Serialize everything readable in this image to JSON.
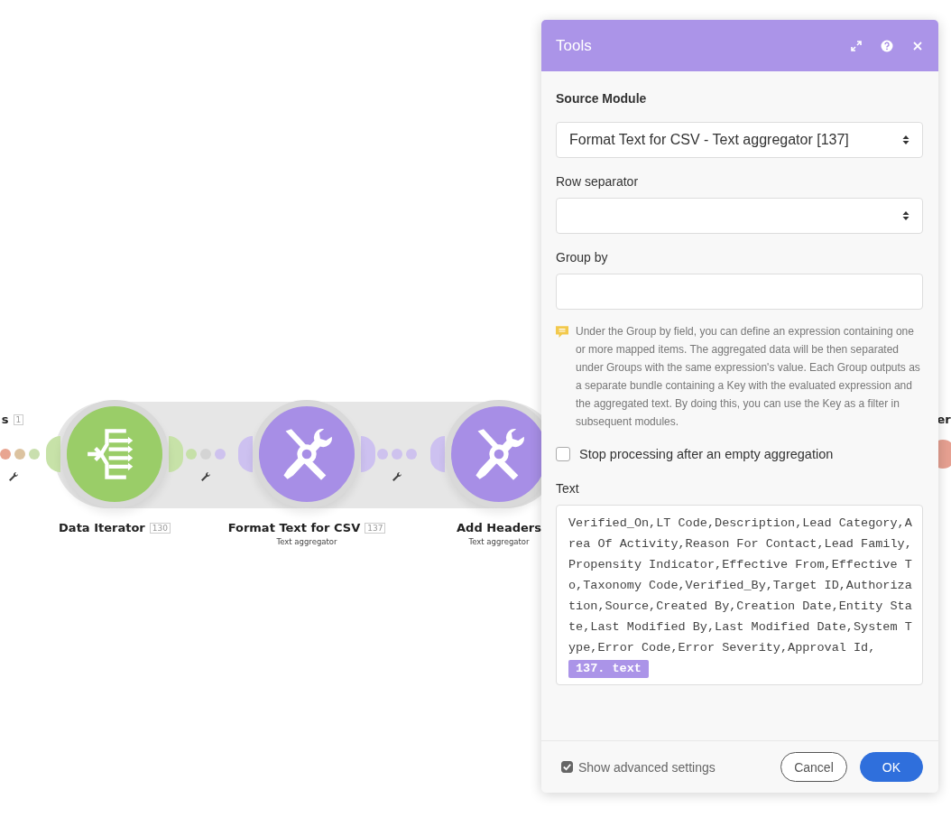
{
  "scenario": {
    "modules": [
      {
        "kind": "partial",
        "label": "s",
        "badge": "1"
      },
      {
        "kind": "iterator",
        "label": "Data Iterator",
        "badge": "130"
      },
      {
        "kind": "tools",
        "label": "Format Text for CSV",
        "badge": "137",
        "subtitle": "Text aggregator"
      },
      {
        "kind": "tools",
        "label": "Add Headers",
        "subtitle": "Text aggregator"
      },
      {
        "kind": "cut",
        "label": "er"
      }
    ]
  },
  "dialog": {
    "title": "Tools",
    "source_module": {
      "label": "Source Module",
      "value": "Format Text for CSV - Text aggregator [137]"
    },
    "row_separator": {
      "label": "Row separator"
    },
    "group_by": {
      "label": "Group by",
      "hint": "Under the Group by field, you can define an expression containing one or more mapped items. The aggregated data will be then separated under Groups with the same expression's value. Each Group outputs as a separate bundle containing a Key with the evaluated expression and the aggregated text. By doing this, you can use the Key as a filter in subsequent modules."
    },
    "stop_processing": {
      "label": "Stop processing after an empty aggregation",
      "checked": false
    },
    "text": {
      "label": "Text",
      "value": "Verified_On,LT Code,Description,Lead Category,Area Of Activity,Reason For Contact,Lead Family,Propensity Indicator,Effective From,Effective To,Taxonomy Code,Verified_By,Target ID,Authorization,Source,Created By,Creation Date,Entity State,Last Modified By,Last Modified Date,System Type,Error Code,Error Severity,Approval Id,",
      "token": "137. text"
    },
    "show_advanced": {
      "label": "Show advanced settings",
      "checked": true
    },
    "buttons": [
      "Cancel",
      "OK"
    ]
  }
}
